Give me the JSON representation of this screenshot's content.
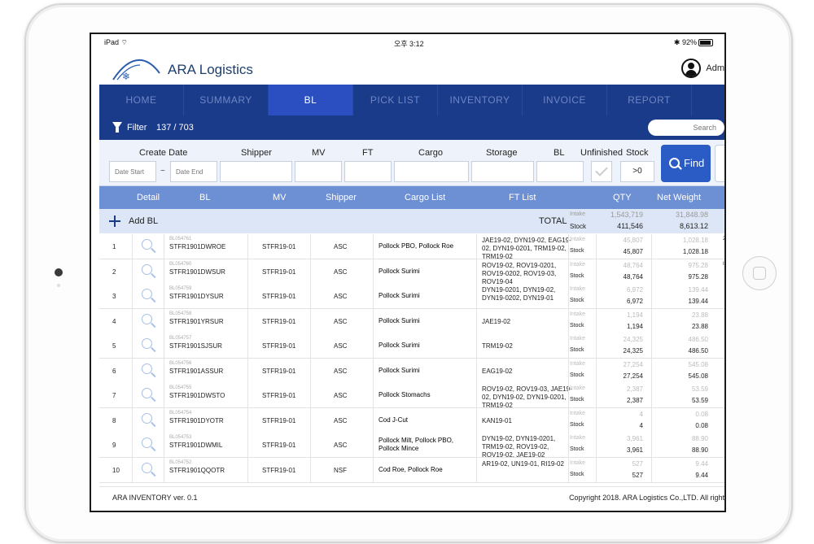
{
  "status_bar": {
    "device": "iPad",
    "time": "오후 3:12",
    "battery": "92%"
  },
  "app": {
    "name": "ARA Logistics",
    "user": "Adm"
  },
  "nav": {
    "tabs": [
      "HOME",
      "SUMMARY",
      "BL",
      "PICK LIST",
      "INVENTORY",
      "INVOICE",
      "REPORT",
      "S"
    ],
    "active": "BL"
  },
  "filter": {
    "label": "Filter",
    "count": "137 / 703",
    "search_placeholder": "Search"
  },
  "criteria": {
    "labels": {
      "create_date": "Create Date",
      "shipper": "Shipper",
      "mv": "MV",
      "ft": "FT",
      "cargo": "Cargo",
      "storage": "Storage",
      "bl": "BL",
      "unfinished": "Unfinished",
      "stock": "Stock"
    },
    "date_start_placeholder": "Date Start",
    "date_end_placeholder": "Date End",
    "tilde": "~",
    "stock_value": ">0",
    "find_label": "Find"
  },
  "table": {
    "headers": [
      "Detail",
      "BL",
      "MV",
      "Shipper",
      "Cargo List",
      "FT List",
      "QTY",
      "Net Weight"
    ],
    "add_label": "Add BL",
    "total_label": "TOTAL",
    "intake_label": "Intake",
    "stock_label": "Stock",
    "total": {
      "intake_qty": "1,543,719",
      "intake_weight": "31,848.98",
      "stock_qty": "411,546",
      "stock_weight": "8,613.12"
    },
    "rows": [
      {
        "no": "1",
        "bl_id": "BL054761",
        "bl": "STFR1901DWROE",
        "mv": "STFR19-01",
        "shipper": "ASC",
        "cargo": "Pollock PBO, Pollock Roe",
        "ft": "JAE19-02, DYN19-02, EAG19-02, DYN19-0201, TRM19-02, TRM19-02",
        "intake_qty": "45,807",
        "intake_weight": "1,028.18",
        "stock_qty": "45,807",
        "stock_weight": "1,028.18",
        "edge": "2"
      },
      {
        "no": "2",
        "bl_id": "BL054760",
        "bl": "STFR1901DWSUR",
        "mv": "STFR19-01",
        "shipper": "ASC",
        "cargo": "Pollock Surimi",
        "ft": "ROV19-02, ROV19-0201, ROV19-0202, ROV19-03, ROV19-04",
        "intake_qty": "48,764",
        "intake_weight": "975.28",
        "stock_qty": "48,764",
        "stock_weight": "975.28",
        "edge": "I"
      },
      {
        "no": "3",
        "bl_id": "BL054759",
        "bl": "STFR1901DYSUR",
        "mv": "STFR19-01",
        "shipper": "ASC",
        "cargo": "Pollock Surimi",
        "ft": "DYN19-0201, DYN19-02, DYN19-0202, DYN19-01",
        "intake_qty": "6,972",
        "intake_weight": "139.44",
        "stock_qty": "6,972",
        "stock_weight": "139.44",
        "edge": ""
      },
      {
        "no": "4",
        "bl_id": "BL054758",
        "bl": "STFR1901YRSUR",
        "mv": "STFR19-01",
        "shipper": "ASC",
        "cargo": "Pollock Surimi",
        "ft": "JAE19-02",
        "intake_qty": "1,194",
        "intake_weight": "23.88",
        "stock_qty": "1,194",
        "stock_weight": "23.88",
        "edge": ""
      },
      {
        "no": "5",
        "bl_id": "BL054757",
        "bl": "STFR1901SJSUR",
        "mv": "STFR19-01",
        "shipper": "ASC",
        "cargo": "Pollock Surimi",
        "ft": "TRM19-02",
        "intake_qty": "24,325",
        "intake_weight": "486.50",
        "stock_qty": "24,325",
        "stock_weight": "486.50",
        "edge": ""
      },
      {
        "no": "6",
        "bl_id": "BL054756",
        "bl": "STFR1901ASSUR",
        "mv": "STFR19-01",
        "shipper": "ASC",
        "cargo": "Pollock Surimi",
        "ft": "EAG19-02",
        "intake_qty": "27,254",
        "intake_weight": "545.08",
        "stock_qty": "27,254",
        "stock_weight": "545.08",
        "edge": ""
      },
      {
        "no": "7",
        "bl_id": "BL054755",
        "bl": "STFR1901DWSTO",
        "mv": "STFR19-01",
        "shipper": "ASC",
        "cargo": "Pollock Stomachs",
        "ft": "ROV19-02, ROV19-03, JAE19-02, DYN19-02, DYN19-0201, TRM19-02",
        "intake_qty": "2,387",
        "intake_weight": "53.59",
        "stock_qty": "2,387",
        "stock_weight": "53.59",
        "edge": ""
      },
      {
        "no": "8",
        "bl_id": "BL054754",
        "bl": "STFR1901DYOTR",
        "mv": "STFR19-01",
        "shipper": "ASC",
        "cargo": "Cod J-Cut",
        "ft": "KAN19-01",
        "intake_qty": "4",
        "intake_weight": "0.08",
        "stock_qty": "4",
        "stock_weight": "0.08",
        "edge": ""
      },
      {
        "no": "9",
        "bl_id": "BL054753",
        "bl": "STFR1901DWMIL",
        "mv": "STFR19-01",
        "shipper": "ASC",
        "cargo": "Pollock Milt, Pollock PBO, Pollock Mince",
        "ft": "DYN19-02, DYN19-0201, TRM19-02, ROV19-02, ROV19-02, JAE19-02",
        "intake_qty": "3,961",
        "intake_weight": "88.90",
        "stock_qty": "3,961",
        "stock_weight": "88.90",
        "edge": ""
      },
      {
        "no": "10",
        "bl_id": "BL054752",
        "bl": "STFR1901QQOTR",
        "mv": "STFR19-01",
        "shipper": "NSF",
        "cargo": "Cod Roe, Pollock Roe",
        "ft": "AR19-02, UN19-01, RI19-02",
        "intake_qty": "527",
        "intake_weight": "9.44",
        "stock_qty": "527",
        "stock_weight": "9.44",
        "edge": ""
      }
    ]
  },
  "footer": {
    "version": "ARA INVENTORY ver. 0.1",
    "copyright": "Copyright 2018. ARA Logistics Co.,LTD. All right"
  },
  "colors": {
    "nav_bg": "#1a3a8a",
    "nav_active": "#2b4fc0",
    "header_bg": "#6d8fd3",
    "find_btn": "#2b5bc5"
  }
}
